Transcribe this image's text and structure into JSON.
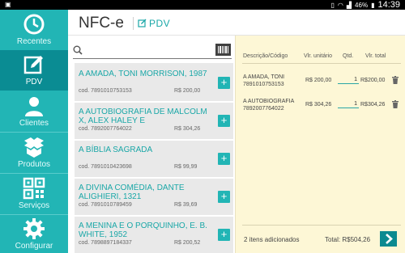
{
  "status_bar": {
    "left_icon": "image-notification-icon",
    "battery": "46%",
    "time": "14:39"
  },
  "sidebar": {
    "items": [
      {
        "label": "Recentes",
        "icon": "clock-icon",
        "active": false
      },
      {
        "label": "PDV",
        "icon": "edit-icon",
        "active": true
      },
      {
        "label": "Clientes",
        "icon": "person-icon",
        "active": false
      },
      {
        "label": "Produtos",
        "icon": "boxes-icon",
        "active": false
      },
      {
        "label": "Serviços",
        "icon": "qr-code-icon",
        "active": false
      },
      {
        "label": "Configurar",
        "icon": "gear-icon",
        "active": false
      }
    ]
  },
  "header": {
    "app_title": "NFC-e",
    "section_title": "PDV"
  },
  "search": {
    "value": "",
    "placeholder": ""
  },
  "products": [
    {
      "name": "A AMADA, TONI MORRISON, 1987",
      "code": "cod. 7891010753153",
      "price": "R$ 200,00"
    },
    {
      "name": "A AUTOBIOGRAFIA DE MALCOLM X, ALEX HALEY E",
      "code": "cod. 7892007764022",
      "price": "R$ 304,26"
    },
    {
      "name": "A BÍBLIA SAGRADA",
      "code": "cod. 7891010423698",
      "price": "R$ 99,99"
    },
    {
      "name": "A DIVINA COMÉDIA, DANTE ALIGHIERI, 1321",
      "code": "cod. 7891010789459",
      "price": "R$ 39,69"
    },
    {
      "name": "A MENINA E O PORQUINHO, E. B. WHITE, 1952",
      "code": "cod. 7898897184337",
      "price": "R$ 200,52"
    }
  ],
  "cart": {
    "headers": {
      "description": "Descrição/Código",
      "unit_price": "Vlr. unitário",
      "qty": "Qtd.",
      "total": "Vlr. total"
    },
    "rows": [
      {
        "name": "A AMADA, TONI",
        "code": "7891010753153",
        "unit_price": "R$ 200,00",
        "qty": "1",
        "total": "R$200,00"
      },
      {
        "name": "A AUTOBIOGRAFIA",
        "code": "7892007764022",
        "unit_price": "R$ 304,26",
        "qty": "1",
        "total": "R$304,26"
      }
    ],
    "items_count_text": "2 itens adicionados",
    "total_label": "Total:",
    "total_value": "R$504,26"
  },
  "colors": {
    "accent": "#22b5b5",
    "accent_dark": "#0a8c93",
    "cart_background": "#fdf7d6"
  }
}
